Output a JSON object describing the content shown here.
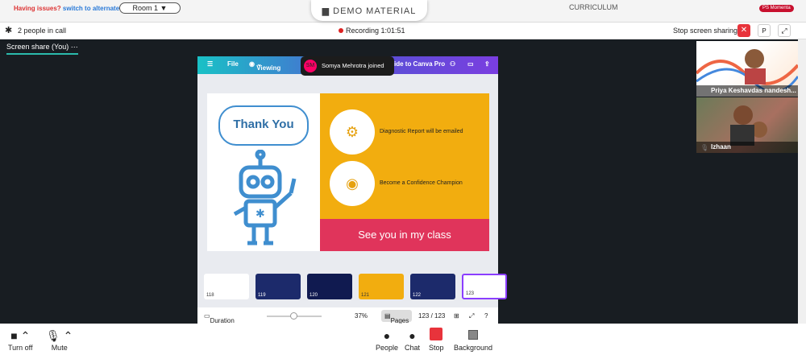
{
  "topbar": {
    "issues": "Having issues?",
    "switch": "switch to alternate room",
    "room": "Room 1",
    "demo": "DEMO MATERIAL",
    "curriculum": "CURRICULUM",
    "badge": "PS Momenta"
  },
  "callbar": {
    "people": "2 people in call",
    "recording": "Recording 1:01:51",
    "stop_sharing": "Stop screen sharing",
    "p": "P"
  },
  "stage": {
    "label": "Screen share (You)"
  },
  "participants": [
    {
      "name": "Priya Keshavdas nandesh..."
    },
    {
      "name": "Izhaan"
    }
  ],
  "canva": {
    "file": "File",
    "viewing": "Viewing",
    "upgrade": "ide to Canva Pro",
    "toast_initials": "SM",
    "toast": "Somya Mehrotra joined",
    "slide": {
      "thank": "Thank You",
      "row1": "Diagnostic Report will be emailed",
      "row2": "Become a Confidence Champion",
      "cta": "See you in my class"
    },
    "thumbs": [
      "118",
      "119",
      "120",
      "121",
      "122",
      "123"
    ],
    "duration": "Duration",
    "zoom": "37%",
    "pages": "Pages",
    "count": "123 / 123"
  },
  "footer": {
    "turnoff": "Turn off",
    "mute": "Mute",
    "people": "People",
    "chat": "Chat",
    "stop": "Stop",
    "background": "Background"
  }
}
